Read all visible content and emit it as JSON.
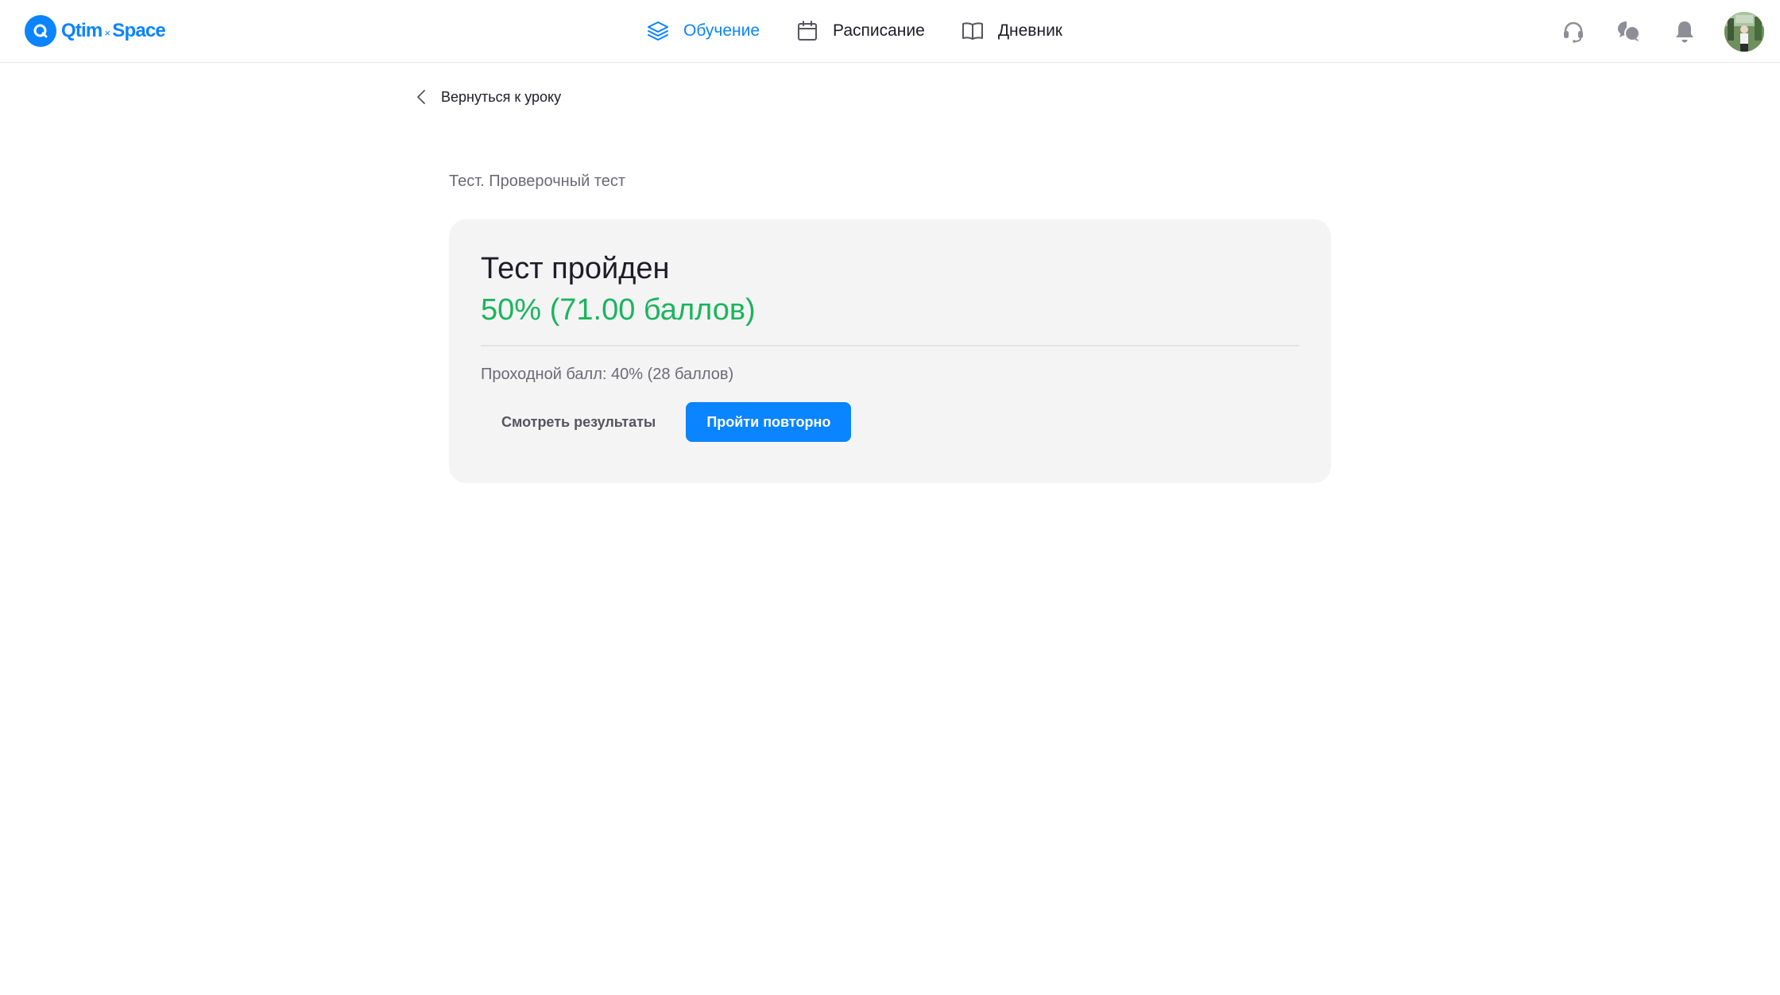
{
  "brand": {
    "left": "Qtim",
    "separator": "×",
    "right": "Space",
    "color": "#0a84ff"
  },
  "nav": {
    "items": [
      {
        "label": "Обучение",
        "icon": "layers-icon",
        "active": true
      },
      {
        "label": "Расписание",
        "icon": "calendar-icon",
        "active": false
      },
      {
        "label": "Дневник",
        "icon": "book-icon",
        "active": false
      }
    ]
  },
  "header_actions": [
    "headset-icon",
    "chat-icon",
    "bell-icon",
    "avatar"
  ],
  "back": {
    "label": "Вернуться к уроку"
  },
  "test": {
    "name": "Тест. Проверочный тест",
    "status": "Тест пройден",
    "score": "50% (71.00 баллов)",
    "pass_score": "Проходной балл: 40% (28 баллов)"
  },
  "buttons": {
    "view_results": "Смотреть результаты",
    "retry": "Пройти повторно"
  },
  "colors": {
    "accent": "#0a84ff",
    "success": "#1ab55c",
    "card_bg": "#f4f4f5",
    "muted_text": "#6b6b76"
  }
}
